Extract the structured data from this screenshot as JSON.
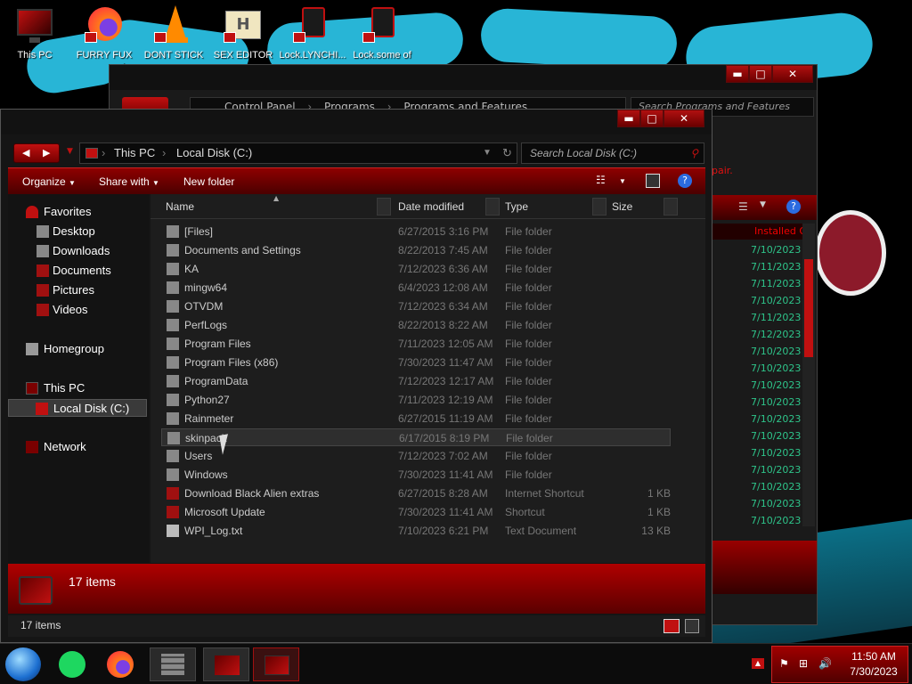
{
  "desktop_icons": [
    {
      "label": "This PC",
      "icon": "monitor-icon"
    },
    {
      "label": "FURRY FUX",
      "icon": "firefox-icon"
    },
    {
      "label": "DONT STICK",
      "icon": "vlc-icon"
    },
    {
      "label": "SEX EDITOR",
      "icon": "hxd-icon"
    },
    {
      "label": "Lock.LYNCHI...",
      "icon": "alien-lock-icon"
    },
    {
      "label": "Lock.some of",
      "icon": "alien-lock-icon"
    }
  ],
  "back_window": {
    "breadcrumb": [
      "Control Panel",
      "Programs",
      "Programs and Features"
    ],
    "search_placeholder": "Search Programs and Features",
    "partial_text": "pair.",
    "column_header": "Installed O",
    "dates": [
      "7/10/2023",
      "7/11/2023",
      "7/11/2023",
      "7/10/2023",
      "7/11/2023",
      "7/12/2023",
      "7/10/2023",
      "7/10/2023",
      "7/10/2023",
      "7/10/2023",
      "7/10/2023",
      "7/10/2023",
      "7/10/2023",
      "7/10/2023",
      "7/10/2023",
      "7/10/2023",
      "7/10/2023"
    ]
  },
  "explorer": {
    "breadcrumb": [
      "This PC",
      "Local Disk (C:)"
    ],
    "search_placeholder": "Search Local Disk (C:)",
    "toolbar": {
      "organize": "Organize",
      "share_with": "Share with",
      "new_folder": "New folder"
    },
    "columns": {
      "name": "Name",
      "date": "Date modified",
      "type": "Type",
      "size": "Size"
    },
    "nav": {
      "favorites": "Favorites",
      "desktop": "Desktop",
      "downloads": "Downloads",
      "documents": "Documents",
      "pictures": "Pictures",
      "videos": "Videos",
      "homegroup": "Homegroup",
      "this_pc": "This PC",
      "local_disk": "Local Disk (C:)",
      "network": "Network"
    },
    "files": [
      {
        "name": "[Files]",
        "date": "6/27/2015 3:16 PM",
        "type": "File folder",
        "size": ""
      },
      {
        "name": "Documents and Settings",
        "date": "8/22/2013 7:45 AM",
        "type": "File folder",
        "size": ""
      },
      {
        "name": "KA",
        "date": "7/12/2023 6:36 AM",
        "type": "File folder",
        "size": ""
      },
      {
        "name": "mingw64",
        "date": "6/4/2023 12:08 AM",
        "type": "File folder",
        "size": ""
      },
      {
        "name": "OTVDM",
        "date": "7/12/2023 6:34 AM",
        "type": "File folder",
        "size": ""
      },
      {
        "name": "PerfLogs",
        "date": "8/22/2013 8:22 AM",
        "type": "File folder",
        "size": ""
      },
      {
        "name": "Program Files",
        "date": "7/11/2023 12:05 AM",
        "type": "File folder",
        "size": ""
      },
      {
        "name": "Program Files (x86)",
        "date": "7/30/2023 11:47 AM",
        "type": "File folder",
        "size": ""
      },
      {
        "name": "ProgramData",
        "date": "7/12/2023 12:17 AM",
        "type": "File folder",
        "size": ""
      },
      {
        "name": "Python27",
        "date": "7/11/2023 12:19 AM",
        "type": "File folder",
        "size": ""
      },
      {
        "name": "Rainmeter",
        "date": "6/27/2015 11:19 AM",
        "type": "File folder",
        "size": ""
      },
      {
        "name": "skinpack",
        "date": "6/17/2015 8:19 PM",
        "type": "File folder",
        "size": ""
      },
      {
        "name": "Users",
        "date": "7/12/2023 7:02 AM",
        "type": "File folder",
        "size": ""
      },
      {
        "name": "Windows",
        "date": "7/30/2023 11:41 AM",
        "type": "File folder",
        "size": ""
      },
      {
        "name": "Download Black Alien extras",
        "date": "6/27/2015 8:28 AM",
        "type": "Internet Shortcut",
        "size": "1 KB"
      },
      {
        "name": "Microsoft Update",
        "date": "7/30/2023 11:41 AM",
        "type": "Shortcut",
        "size": "1 KB"
      },
      {
        "name": "WPI_Log.txt",
        "date": "7/10/2023 6:21 PM",
        "type": "Text Document",
        "size": "13 KB"
      }
    ],
    "details_count": "17 items",
    "status_count": "17 items"
  },
  "taskbar": {
    "time": "11:50 AM",
    "date": "7/30/2023"
  },
  "colors": {
    "accent_red": "#b00000",
    "wallpaper_cyan": "#28b5d6",
    "green_dates": "#2ec48a"
  }
}
